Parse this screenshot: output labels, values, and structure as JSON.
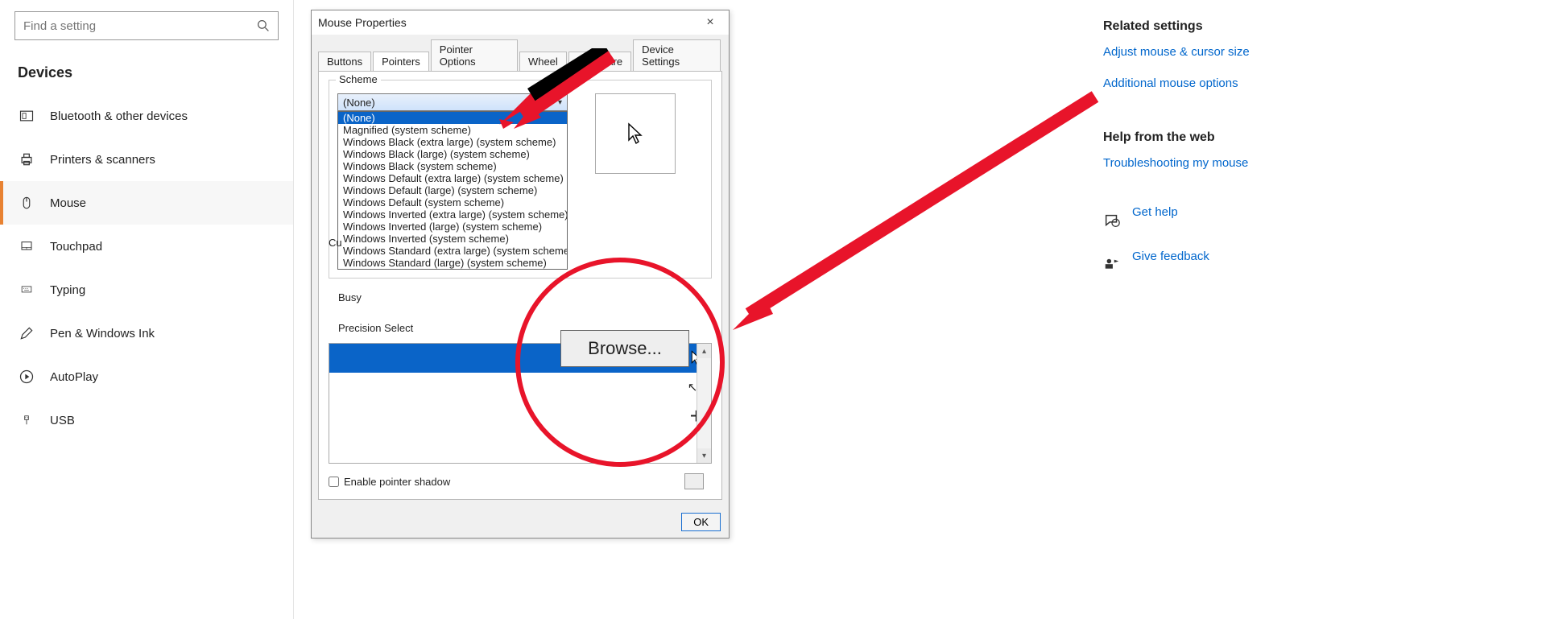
{
  "sidebar": {
    "search_placeholder": "Find a setting",
    "heading": "Devices",
    "items": [
      {
        "label": "Bluetooth & other devices",
        "icon": "bluetooth"
      },
      {
        "label": "Printers & scanners",
        "icon": "printer"
      },
      {
        "label": "Mouse",
        "icon": "mouse",
        "selected": true
      },
      {
        "label": "Touchpad",
        "icon": "touchpad"
      },
      {
        "label": "Typing",
        "icon": "keyboard"
      },
      {
        "label": "Pen & Windows Ink",
        "icon": "pen"
      },
      {
        "label": "AutoPlay",
        "icon": "autoplay"
      },
      {
        "label": "USB",
        "icon": "usb"
      }
    ]
  },
  "rightcol": {
    "related_heading": "Related settings",
    "links": [
      "Adjust mouse & cursor size",
      "Additional mouse options"
    ],
    "help_heading": "Help from the web",
    "help_links": [
      "Troubleshooting my mouse"
    ],
    "action_links": [
      {
        "label": "Get help",
        "icon": "chat"
      },
      {
        "label": "Give feedback",
        "icon": "feedback"
      }
    ]
  },
  "dialog": {
    "title": "Mouse Properties",
    "close": "×",
    "tabs": [
      "Buttons",
      "Pointers",
      "Pointer Options",
      "Wheel",
      "Hardware",
      "Device Settings"
    ],
    "active_tab": "Pointers",
    "scheme_legend": "Scheme",
    "scheme_selected": "(None)",
    "scheme_options": [
      "(None)",
      "Magnified (system scheme)",
      "Windows Black (extra large) (system scheme)",
      "Windows Black (large) (system scheme)",
      "Windows Black (system scheme)",
      "Windows Default (extra large) (system scheme)",
      "Windows Default (large) (system scheme)",
      "Windows Default (system scheme)",
      "Windows Inverted (extra large) (system scheme)",
      "Windows Inverted (large) (system scheme)",
      "Windows Inverted (system scheme)",
      "Windows Standard (extra large) (system scheme)",
      "Windows Standard (large) (system scheme)"
    ],
    "highlighted_option_index": 0,
    "customize_partial": "Cu",
    "cursor_rows": [
      {
        "label": "",
        "selected": true,
        "icon": "arrow"
      },
      {
        "label": "",
        "selected": false,
        "icon": "arrow-question"
      },
      {
        "label": "",
        "selected": false,
        "icon": "plus-cursor"
      }
    ],
    "busy_label": "Busy",
    "precision_label": "Precision Select",
    "shadow_label": "Enable pointer shadow",
    "browse_label": "Browse...",
    "buttons": {
      "ok": "OK"
    }
  }
}
